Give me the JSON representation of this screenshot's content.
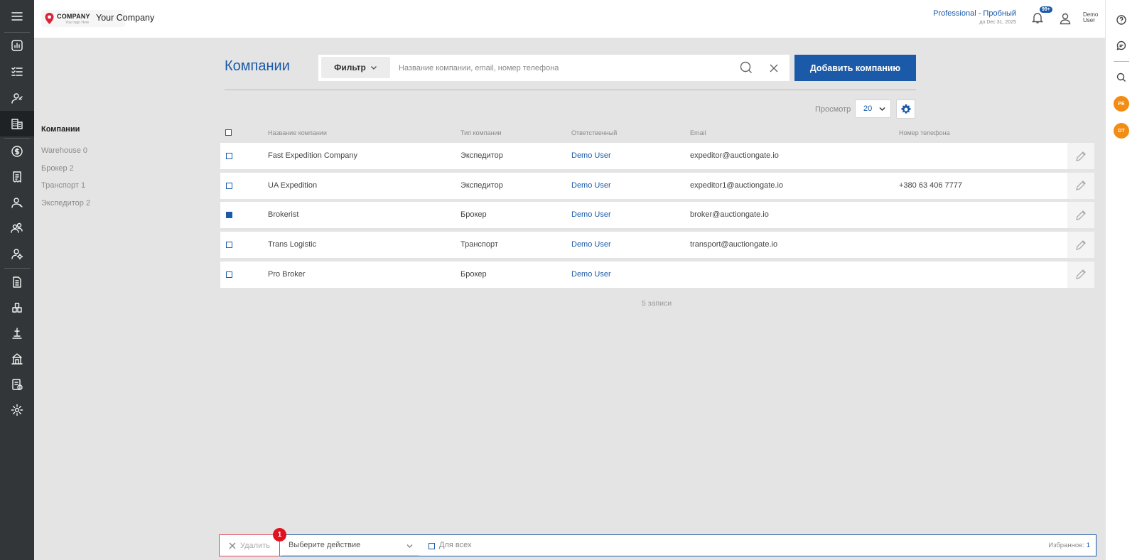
{
  "header": {
    "logo_text": "COMPANY",
    "logo_sub": "Your logo Here",
    "company_name": "Your Company",
    "plan_name": "Professional - Пробный",
    "plan_date": "до Dec 31, 2025",
    "notifications_badge": "99+",
    "user_name_line1": "Demo",
    "user_name_line2": "User"
  },
  "subnav": {
    "title": "Компании",
    "items": [
      {
        "label": "Warehouse 0"
      },
      {
        "label": "Брокер 2"
      },
      {
        "label": "Транспорт 1"
      },
      {
        "label": "Экспедитор 2"
      }
    ]
  },
  "main": {
    "title": "Компании",
    "filter_label": "Фильтр",
    "search_placeholder": "Название компании, email, номер телефона",
    "search_value": "",
    "add_button": "Добавить компанию",
    "view_label": "Просмотр",
    "view_value": "20"
  },
  "table": {
    "columns": [
      "Название компании",
      "Тип компании",
      "Ответственный",
      "Email",
      "Номер телефона"
    ],
    "rows": [
      {
        "name": "Fast Expedition Company",
        "type": "Экспедитор",
        "owner": "Demo User",
        "email": "expeditor@auctiongate.io",
        "phone": "",
        "checked": false
      },
      {
        "name": "UA Expedition",
        "type": "Экспедитор",
        "owner": "Demo User",
        "email": "expeditor1@auctiongate.io",
        "phone": "+380 63 406 7777",
        "checked": false
      },
      {
        "name": "Brokerist",
        "type": "Брокер",
        "owner": "Demo User",
        "email": "broker@auctiongate.io",
        "phone": "",
        "checked": true
      },
      {
        "name": "Trans Logistic",
        "type": "Транспорт",
        "owner": "Demo User",
        "email": "transport@auctiongate.io",
        "phone": "",
        "checked": false
      },
      {
        "name": "Pro Broker",
        "type": "Брокер",
        "owner": "Demo User",
        "email": "",
        "phone": "",
        "checked": false
      }
    ],
    "records_count": "5 записи"
  },
  "bottom_bar": {
    "delete_label": "Удалить",
    "selected_count": "1",
    "action_placeholder": "Выберите действие",
    "for_all_label": "Для всех",
    "favorites_label": "Избранное:",
    "favorites_count": "1"
  },
  "right_rail": {
    "avatars": [
      "PE",
      "DT"
    ]
  },
  "colors": {
    "accent": "#1a5aa8",
    "sidebar": "#333638",
    "avatar": "#f28c13",
    "badge": "#e3101e"
  }
}
